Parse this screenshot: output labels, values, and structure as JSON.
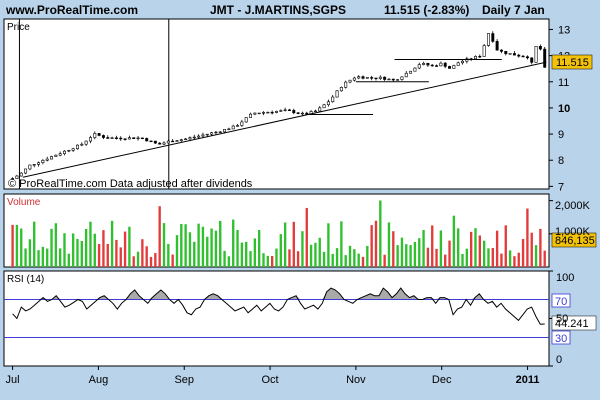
{
  "header": {
    "site": "www.ProRealTime.com",
    "instrument": "JMT - J.MARTINS,SGPS",
    "quote": "11.515 (-2.83%)",
    "period": "Daily 7 Jan"
  },
  "colors": {
    "up": "#2fbf2f",
    "down": "#e23b3b",
    "rsi_fill": "#a9a9a9",
    "bg": "#b9d3ea",
    "panel": "#ffffff"
  },
  "chart_data": [
    {
      "type": "line",
      "panel": "price",
      "label": "Price",
      "annotation": "© ProRealTime.com Data adjusted after dividends",
      "last_value_tag": "11.515",
      "y_ticks": [
        "13",
        "12",
        "11",
        "10",
        "9",
        "8",
        "7"
      ],
      "ylim": [
        6.9,
        13.4
      ],
      "x_ticks": [
        "Jul",
        "Aug",
        "Sep",
        "Oct",
        "Nov",
        "Dec",
        "2011"
      ],
      "x_tick_months": [
        0,
        1,
        2,
        3,
        4,
        5,
        6
      ],
      "x_range_months": [
        -0.1,
        6.25
      ],
      "close_series": [
        [
          0.0,
          7.3
        ],
        [
          0.1,
          7.5
        ],
        [
          0.2,
          7.8
        ],
        [
          0.35,
          8.0
        ],
        [
          0.5,
          8.2
        ],
        [
          0.65,
          8.4
        ],
        [
          0.8,
          8.6
        ],
        [
          0.95,
          9.0
        ],
        [
          1.1,
          8.85
        ],
        [
          1.3,
          8.85
        ],
        [
          1.5,
          8.85
        ],
        [
          1.7,
          8.6
        ],
        [
          1.85,
          8.75
        ],
        [
          2.0,
          8.8
        ],
        [
          2.2,
          8.95
        ],
        [
          2.4,
          9.1
        ],
        [
          2.6,
          9.3
        ],
        [
          2.8,
          9.8
        ],
        [
          3.0,
          9.85
        ],
        [
          3.2,
          9.9
        ],
        [
          3.4,
          9.75
        ],
        [
          3.55,
          9.9
        ],
        [
          3.7,
          10.3
        ],
        [
          3.85,
          10.9
        ],
        [
          4.0,
          11.2
        ],
        [
          4.15,
          11.15
        ],
        [
          4.3,
          11.15
        ],
        [
          4.45,
          11.05
        ],
        [
          4.6,
          11.35
        ],
        [
          4.75,
          11.7
        ],
        [
          4.9,
          11.6
        ],
        [
          5.0,
          11.7
        ],
        [
          5.1,
          11.5
        ],
        [
          5.2,
          11.75
        ],
        [
          5.35,
          11.9
        ],
        [
          5.45,
          12.0
        ],
        [
          5.55,
          12.9
        ],
        [
          5.65,
          12.2
        ],
        [
          5.75,
          12.1
        ],
        [
          5.9,
          12.0
        ],
        [
          6.0,
          11.95
        ],
        [
          6.05,
          11.7
        ],
        [
          6.1,
          12.35
        ],
        [
          6.15,
          12.25
        ],
        [
          6.2,
          11.515
        ]
      ],
      "trendline": [
        [
          0.12,
          7.35
        ],
        [
          6.22,
          11.75
        ]
      ],
      "horizontal_levels": [
        {
          "value": 9.75,
          "from_month": 3.45,
          "to_month": 4.2
        },
        {
          "value": 11.0,
          "from_month": 4.0,
          "to_month": 4.85
        },
        {
          "value": 11.85,
          "from_month": 4.45,
          "to_month": 5.7
        }
      ],
      "vertical_markers_months": [
        0.08,
        1.82
      ]
    },
    {
      "type": "bar",
      "panel": "volume",
      "label": "Volume",
      "y_ticks": [
        "2,000K",
        "1,000K"
      ],
      "ylim": [
        0,
        2200000
      ],
      "last_value_tag": "846,135",
      "note": "daily volume bars, green on up days, red on down days"
    },
    {
      "type": "line",
      "panel": "rsi",
      "label": "RSI (14)",
      "y_ticks": [
        "100",
        "50",
        "0"
      ],
      "ylim": [
        0,
        100
      ],
      "levels": [
        "70",
        "30"
      ],
      "last_value_tag": "44.241",
      "values": [
        55,
        50,
        62,
        58,
        60,
        64,
        68,
        72,
        68,
        70,
        74,
        68,
        62,
        64,
        67,
        70,
        68,
        60,
        64,
        68,
        72,
        74,
        70,
        66,
        60,
        66,
        70,
        76,
        80,
        74,
        70,
        66,
        72,
        76,
        80,
        76,
        70,
        66,
        70,
        64,
        56,
        54,
        60,
        62,
        70,
        74,
        76,
        74,
        70,
        66,
        62,
        58,
        60,
        62,
        56,
        60,
        64,
        58,
        62,
        66,
        60,
        58,
        62,
        70,
        72,
        74,
        66,
        60,
        62,
        64,
        60,
        66,
        78,
        82,
        80,
        76,
        70,
        68,
        66,
        70,
        72,
        74,
        76,
        74,
        74,
        82,
        78,
        72,
        76,
        82,
        76,
        72,
        74,
        70,
        70,
        72,
        72,
        66,
        72,
        72,
        70,
        54,
        60,
        62,
        70,
        64,
        72,
        76,
        70,
        66,
        68,
        62,
        66,
        60,
        56,
        52,
        48,
        54,
        60,
        62,
        52,
        44,
        44.241
      ]
    }
  ]
}
